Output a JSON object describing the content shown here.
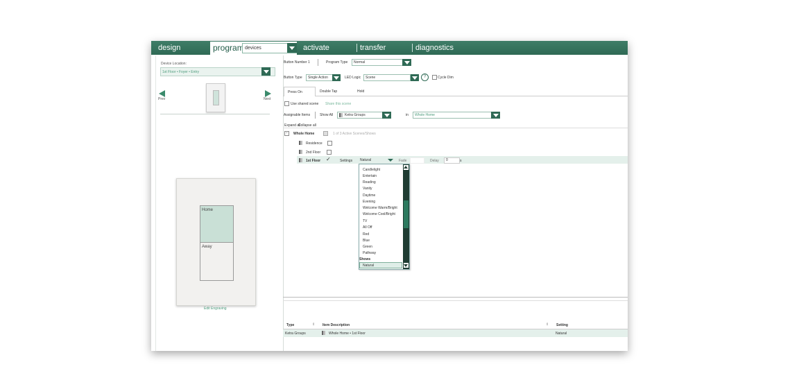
{
  "nav": {
    "design": "design",
    "program": "program",
    "devices": "devices",
    "activate": "activate",
    "transfer": "transfer",
    "diagnostics": "diagnostics"
  },
  "left": {
    "device_location_label": "Device Location:",
    "device_location_value": "1st Floor • Foyer • Entry",
    "prev": "Prev",
    "next": "Next",
    "keypad_buttons": [
      "Home",
      "Away"
    ],
    "edit_engraving": "Edit Engraving"
  },
  "top": {
    "button_number": "Button Number 1",
    "program_type_label": "Program Type",
    "program_type_value": "Normal",
    "button_type_label": "Button Type",
    "button_type_value": "Single Action",
    "led_logic_label": "LED Logic",
    "led_logic_value": "Scene",
    "help": "?",
    "cycle_dim": "Cycle Dim"
  },
  "tabs": [
    "Press On",
    "Double Tap",
    "Hold"
  ],
  "scene": {
    "use_shared": "Use shared scene",
    "share": "Share this scene",
    "assignable_label": "Assignable Items",
    "show_all": "Show All",
    "ketra_groups": "Ketra Groups",
    "in_label": "in",
    "in_value": "Whole Home",
    "expand_all": "Expand all",
    "collapse_all": "Collapse all"
  },
  "tree": {
    "root": "Whole Home",
    "root_status": "1 of 3 Active Scenes/Shows",
    "residence": "Residence",
    "second_floor": "2nd Floor",
    "first_floor": "1st Floor",
    "settings_label": "Settings",
    "settings_value": "Natural",
    "fade_label": "Fade",
    "delay_label": "Delay",
    "delay_value": "0",
    "delay_unit": "s"
  },
  "dropdown": {
    "items": [
      "Candlelight",
      "Entertain",
      "Reading",
      "Vanity",
      "Daytime",
      "Evening",
      "Welcome Warm/Bright",
      "Welcome Cool/Bright",
      "TV",
      "All Off",
      "Red",
      "Blue",
      "Green",
      "Pathway"
    ],
    "shows_header": "Shows",
    "selected": "Natural"
  },
  "table": {
    "headers": [
      "Type",
      "Item Description",
      "Setting"
    ],
    "row": {
      "type": "Ketra Groups",
      "description": "Whole Home • 1st Floor",
      "setting": "Natural"
    }
  },
  "colors": {
    "brand_green": "#2f6a55",
    "accent_light": "#cfe3db"
  }
}
